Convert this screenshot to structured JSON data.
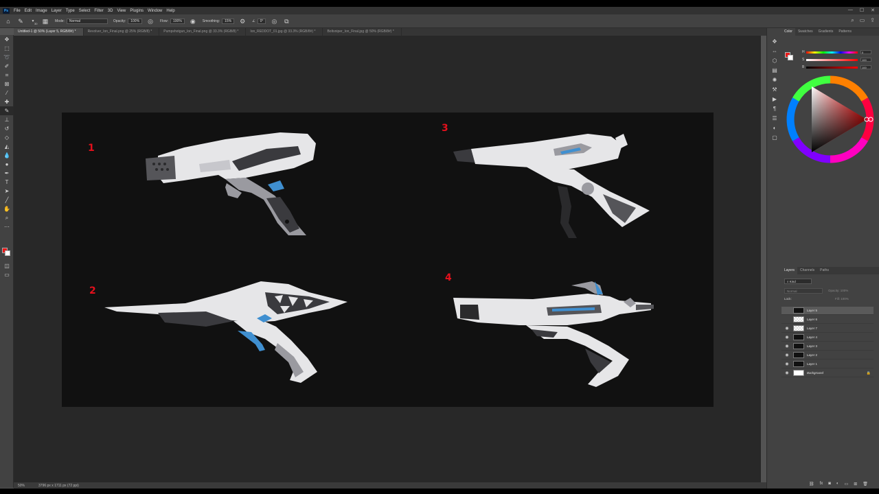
{
  "app": {
    "logo": "Ps",
    "menu": [
      "File",
      "Edit",
      "Image",
      "Layer",
      "Type",
      "Select",
      "Filter",
      "3D",
      "View",
      "Plugins",
      "Window",
      "Help"
    ],
    "window_controls": [
      "—",
      "☐",
      "✕"
    ]
  },
  "options": {
    "brush_size": "30",
    "mode_label": "Mode:",
    "mode_value": "Normal",
    "opacity_label": "Opacity:",
    "opacity_value": "100%",
    "flow_label": "Flow:",
    "flow_value": "100%",
    "smoothing_label": "Smoothing:",
    "smoothing_value": "15%",
    "angle_value": "0°"
  },
  "tabs": [
    {
      "label": "Untitled-1 @ 50% (Layer 5, RGB/8#) *",
      "active": true
    },
    {
      "label": "Revolver_Ion_Final.png @ 25% (RGB/8) *",
      "active": false
    },
    {
      "label": "Pumpshotgun_Ion_Final.png @ 33.3% (RGB/8) *",
      "active": false
    },
    {
      "label": "Ion_REDDOT_01.jpg @ 33.3% (RGB/8#) *",
      "active": false
    },
    {
      "label": "Boltsniper_Ion_Final.jpg @ 50% (RGB/8#) *",
      "active": false
    }
  ],
  "canvas": {
    "labels": [
      "1",
      "2",
      "3",
      "4"
    ],
    "colors": {
      "background": "#111111",
      "label": "#e4101c",
      "body": "#e6e6e8",
      "shade": "#9a9aa0",
      "dark": "#3a3a3e",
      "accent": "#3f8fd0"
    }
  },
  "status": {
    "zoom": "50%",
    "doc_size": "3796 px x 1711 px (72 ppi)"
  },
  "color_panel": {
    "tabs": [
      "Color",
      "Swatches",
      "Gradients",
      "Patterns"
    ],
    "h_label": "H",
    "h_value": "0",
    "s_label": "S",
    "s_value": "100",
    "b_label": "B",
    "b_value": "100",
    "foreground": "#e81919"
  },
  "layers_panel": {
    "tabs": [
      "Layers",
      "Channels",
      "Paths"
    ],
    "filter": "Kind",
    "blend_mode": "Normal",
    "opacity_label": "Opacity:",
    "opacity_value": "100%",
    "lock_label": "Lock:",
    "fill_label": "Fill:",
    "fill_value": "100%",
    "layers": [
      {
        "name": "Layer 5",
        "visible": false,
        "selected": true,
        "thumb": "dark"
      },
      {
        "name": "Layer 6",
        "visible": false,
        "selected": false,
        "thumb": "trans"
      },
      {
        "name": "Layer 7",
        "visible": true,
        "selected": false,
        "thumb": "trans"
      },
      {
        "name": "Layer 4",
        "visible": true,
        "selected": false,
        "thumb": "dark"
      },
      {
        "name": "Layer 3",
        "visible": true,
        "selected": false,
        "thumb": "dark"
      },
      {
        "name": "Layer 2",
        "visible": true,
        "selected": false,
        "thumb": "dark"
      },
      {
        "name": "Layer 1",
        "visible": true,
        "selected": false,
        "thumb": "dark"
      },
      {
        "name": "Background",
        "visible": true,
        "selected": false,
        "thumb": "white"
      }
    ]
  }
}
